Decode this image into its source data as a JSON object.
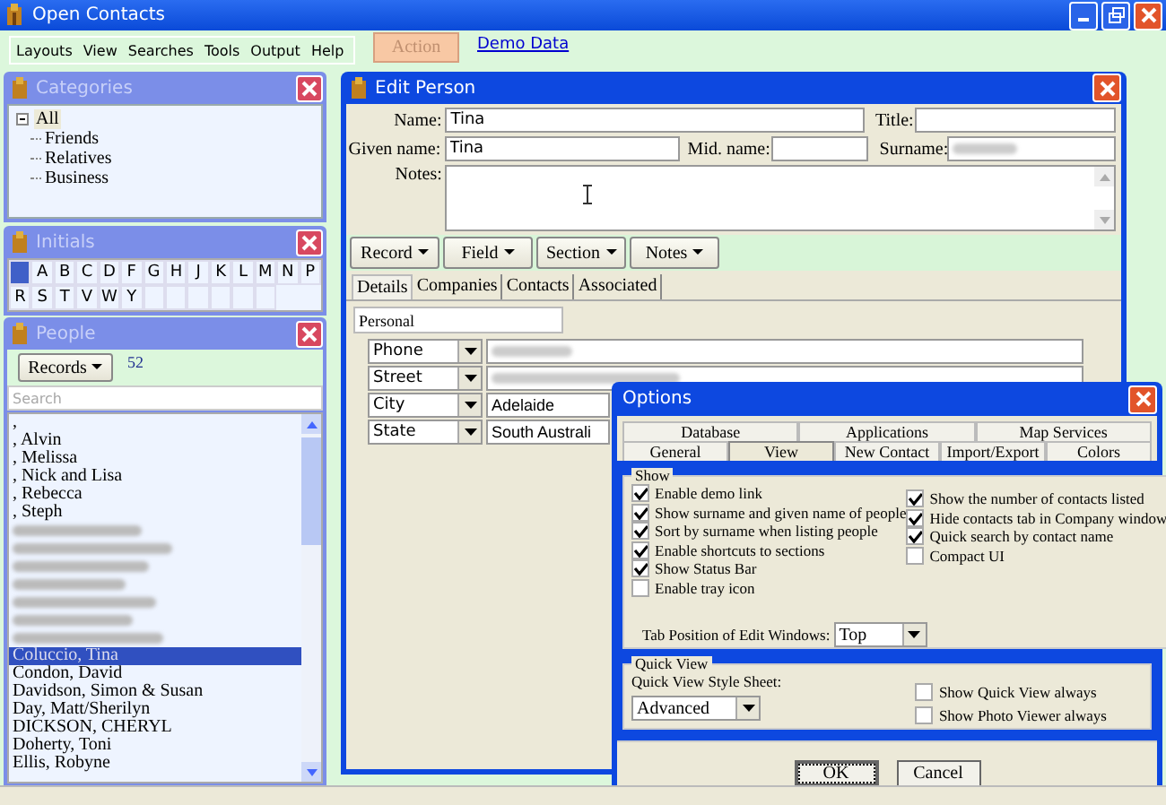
{
  "window": {
    "title": "Open Contacts"
  },
  "menu": [
    "Layouts",
    "View",
    "Searches",
    "Tools",
    "Output",
    "Help"
  ],
  "action_button": {
    "label": "Action",
    "disabled": true
  },
  "demo_link": "Demo Data",
  "categories": {
    "title": "Categories",
    "tree": [
      {
        "label": "All",
        "selected": true,
        "expanded": true,
        "children": [
          {
            "label": "Friends",
            "selected": false
          },
          {
            "label": "Relatives",
            "selected": false
          },
          {
            "label": "Business",
            "selected": false
          }
        ]
      }
    ]
  },
  "initials": {
    "title": "Initials",
    "letters": [
      {
        "selected": true
      },
      {
        "label": "A",
        "selected": false
      },
      {
        "label": "B",
        "selected": false
      },
      {
        "label": "C",
        "selected": false
      },
      {
        "label": "D",
        "selected": false
      },
      {
        "label": "F",
        "selected": false
      },
      {
        "label": "G",
        "selected": false
      },
      {
        "label": "H",
        "selected": false
      },
      {
        "label": "J",
        "selected": false
      },
      {
        "label": "K",
        "selected": false
      },
      {
        "label": "L",
        "selected": false
      },
      {
        "label": "M",
        "selected": false
      },
      {
        "label": "N",
        "selected": false
      },
      {
        "label": "P",
        "selected": false
      },
      {
        "label": "R",
        "selected": false
      },
      {
        "label": "S",
        "selected": false
      },
      {
        "label": "T",
        "selected": false
      },
      {
        "label": "V",
        "selected": false
      },
      {
        "label": "W",
        "selected": false
      },
      {
        "label": "Y",
        "selected": false
      }
    ]
  },
  "people": {
    "title": "People",
    "records_button": "Records",
    "count": "52",
    "search_placeholder": "Search",
    "rows": [
      {
        "name": ",",
        "selected": false
      },
      {
        "name": ", Alvin",
        "selected": false
      },
      {
        "name": ", Melissa",
        "selected": false
      },
      {
        "name": ", Nick and Lisa",
        "selected": false
      },
      {
        "name": ", Rebecca",
        "selected": false
      },
      {
        "name": ", Steph",
        "selected": false
      },
      {
        "redacted": true,
        "selected": false
      },
      {
        "redacted": true,
        "selected": false
      },
      {
        "redacted": true,
        "selected": false
      },
      {
        "redacted": true,
        "selected": false
      },
      {
        "redacted": true,
        "selected": false
      },
      {
        "redacted": true,
        "selected": false
      },
      {
        "redacted": true,
        "selected": false
      },
      {
        "name": "Coluccio, Tina",
        "selected": true
      },
      {
        "name": "Condon, David",
        "selected": false
      },
      {
        "name": "Davidson, Simon & Susan",
        "selected": false
      },
      {
        "name": "Day, Matt/Sherilyn",
        "selected": false
      },
      {
        "name": "DICKSON, CHERYL",
        "selected": false
      },
      {
        "name": "Doherty, Toni",
        "selected": false
      },
      {
        "name": "Ellis, Robyne",
        "selected": false
      }
    ]
  },
  "edit_person": {
    "title": "Edit Person",
    "name_label": "Name:",
    "name_value": "Tina",
    "title_label": "Title:",
    "given_label": "Given name:",
    "given_value": "Tina",
    "mid_label": "Mid. name:",
    "surname_label": "Surname:",
    "surname_redacted": true,
    "notes_label": "Notes:",
    "toolbar": [
      "Record",
      "Field",
      "Section",
      "Notes"
    ],
    "tabs": [
      {
        "label": "Details",
        "selected": true
      },
      {
        "label": "Companies",
        "selected": false
      },
      {
        "label": "Contacts",
        "selected": false
      },
      {
        "label": "Associated",
        "selected": false
      }
    ],
    "section": "Personal",
    "detail_rows": [
      {
        "type": "Phone",
        "redacted": true
      },
      {
        "type": "Street",
        "redacted": true
      },
      {
        "type": "City",
        "value": "Adelaide"
      },
      {
        "type": "State",
        "value": "South Australi"
      }
    ]
  },
  "options": {
    "title": "Options",
    "tab_rows": [
      [
        {
          "label": "Database",
          "selected": false
        },
        {
          "label": "Applications",
          "selected": false
        },
        {
          "label": "Map Services",
          "selected": false
        }
      ],
      [
        {
          "label": "General",
          "selected": false
        },
        {
          "label": "View",
          "selected": true
        },
        {
          "label": "New Contact",
          "selected": false
        },
        {
          "label": "Import/Export",
          "selected": false
        },
        {
          "label": "Colors",
          "selected": false
        }
      ]
    ],
    "show": {
      "title": "Show",
      "left": [
        {
          "label": "Enable demo link",
          "checked": true
        },
        {
          "label": "Show surname and given name of people",
          "checked": true
        },
        {
          "label": "Sort by surname when listing people",
          "checked": true
        },
        {
          "label": "Enable shortcuts to sections",
          "checked": true
        },
        {
          "label": "Show Status Bar",
          "checked": true
        },
        {
          "label": "Enable tray icon",
          "checked": false
        }
      ],
      "right": [
        {
          "label": "Show the number of contacts listed",
          "checked": true
        },
        {
          "label": "Hide contacts tab in Company window",
          "checked": true
        },
        {
          "label": "Quick search by contact name",
          "checked": true
        },
        {
          "label": "Compact UI",
          "checked": false
        }
      ],
      "tab_position_label": "Tab Position of Edit Windows:",
      "tab_position": "Top"
    },
    "quick_view": {
      "title": "Quick View",
      "style_label": "Quick View Style Sheet:",
      "style": "Advanced",
      "checks": [
        {
          "label": "Show Quick View always",
          "checked": false
        },
        {
          "label": "Show Photo Viewer always",
          "checked": false
        }
      ]
    },
    "buttons": [
      {
        "label": "OK",
        "default": true
      },
      {
        "label": "Cancel",
        "default": false
      }
    ]
  }
}
